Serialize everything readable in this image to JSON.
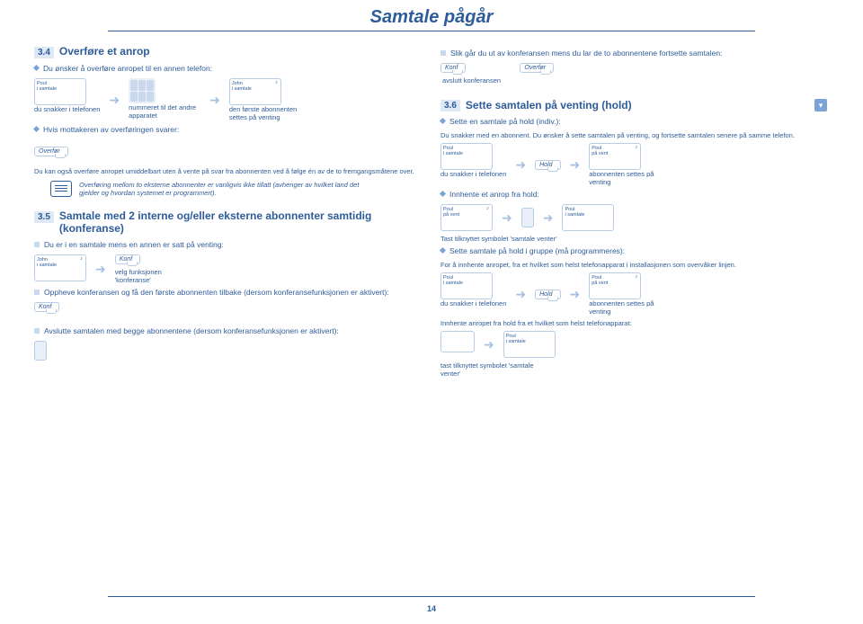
{
  "page_title": "Samtale pågår",
  "page_number": "14",
  "left": {
    "s34": {
      "num": "3.4",
      "title": "Overføre et anrop",
      "intro": "Du ønsker å overføre anropet til en annen telefon:",
      "phone1_line1": "Poul",
      "phone1_line2": "i samtale",
      "phone2_line1": "John",
      "phone2_line2": "i samtale",
      "cap1": "du snakker i telefonen",
      "cap2": "nummeret til det andre apparatet",
      "cap3": "den første abonnenten settes på venting",
      "sub1": "Hvis mottakeren av overføringen svarer:",
      "softkey_transfer": "Overfør",
      "body1": "Du kan også overføre anropet umiddelbart uten å vente på svar fra abonnenten ved å følge én av de to fremgangsmåtene over.",
      "note": "Overføring mellom to eksterne abonnenter er vanligvis ikke tillatt (avhenger av hvilket land det gjelder og hvordan systemet er programmert)."
    },
    "s35": {
      "num": "3.5",
      "title": "Samtale med 2 interne og/eller eksterne abonnenter samtidig (konferanse)",
      "intro": "Du er i en samtale mens en annen er satt på venting:",
      "phone_line1": "John",
      "phone_line2": "i samtale",
      "softkey_konf": "Konf",
      "cap1": "velg funksjonen 'konferanse'",
      "body1": "Oppheve konferansen og få den første abonnenten tilbake (dersom konferansefunksjonen er aktivert):",
      "body2": "Avslutte samtalen med begge abonnentene (dersom konferansefunksjonen er aktivert):"
    }
  },
  "right": {
    "top_intro": "Slik går du ut av konferansen mens du lar de to abonnentene fortsette samtalen:",
    "softkey_konf": "Konf",
    "softkey_transfer": "Overfør",
    "cap_end": "avslutt konferansen",
    "s36": {
      "num": "3.6",
      "title": "Sette samtalen på venting (hold)",
      "sub1": "Sette en samtale på hold (indiv.):",
      "body1": "Du snakker med en abonnent. Du ønsker å sette samtalen på venting, og fortsette samtalen senere på samme telefon.",
      "softkey_hold": "Hold",
      "phone1_l1": "Poul",
      "phone1_l2": "i samtale",
      "phone2_l1": "Poul",
      "phone2_l2": "på vent",
      "cap1": "du snakker i telefonen",
      "cap2": "abonnenten settes på venting",
      "sub2": "Innhente et anrop fra hold:",
      "body2": "Tast tilknyttet symbolet 'samtale venter'",
      "sub3": "Sette samtale på hold i gruppe (må programmeres):",
      "body3": "For å innhente anropet, fra et hvilket som helst telefonapparat i installasjonen som overvåker linjen.",
      "body4": "Innhente anropet fra hold fra et hvilket som helst telefonapparat:",
      "body5": "tast tilknyttet symbolet 'samtale venter'"
    }
  }
}
